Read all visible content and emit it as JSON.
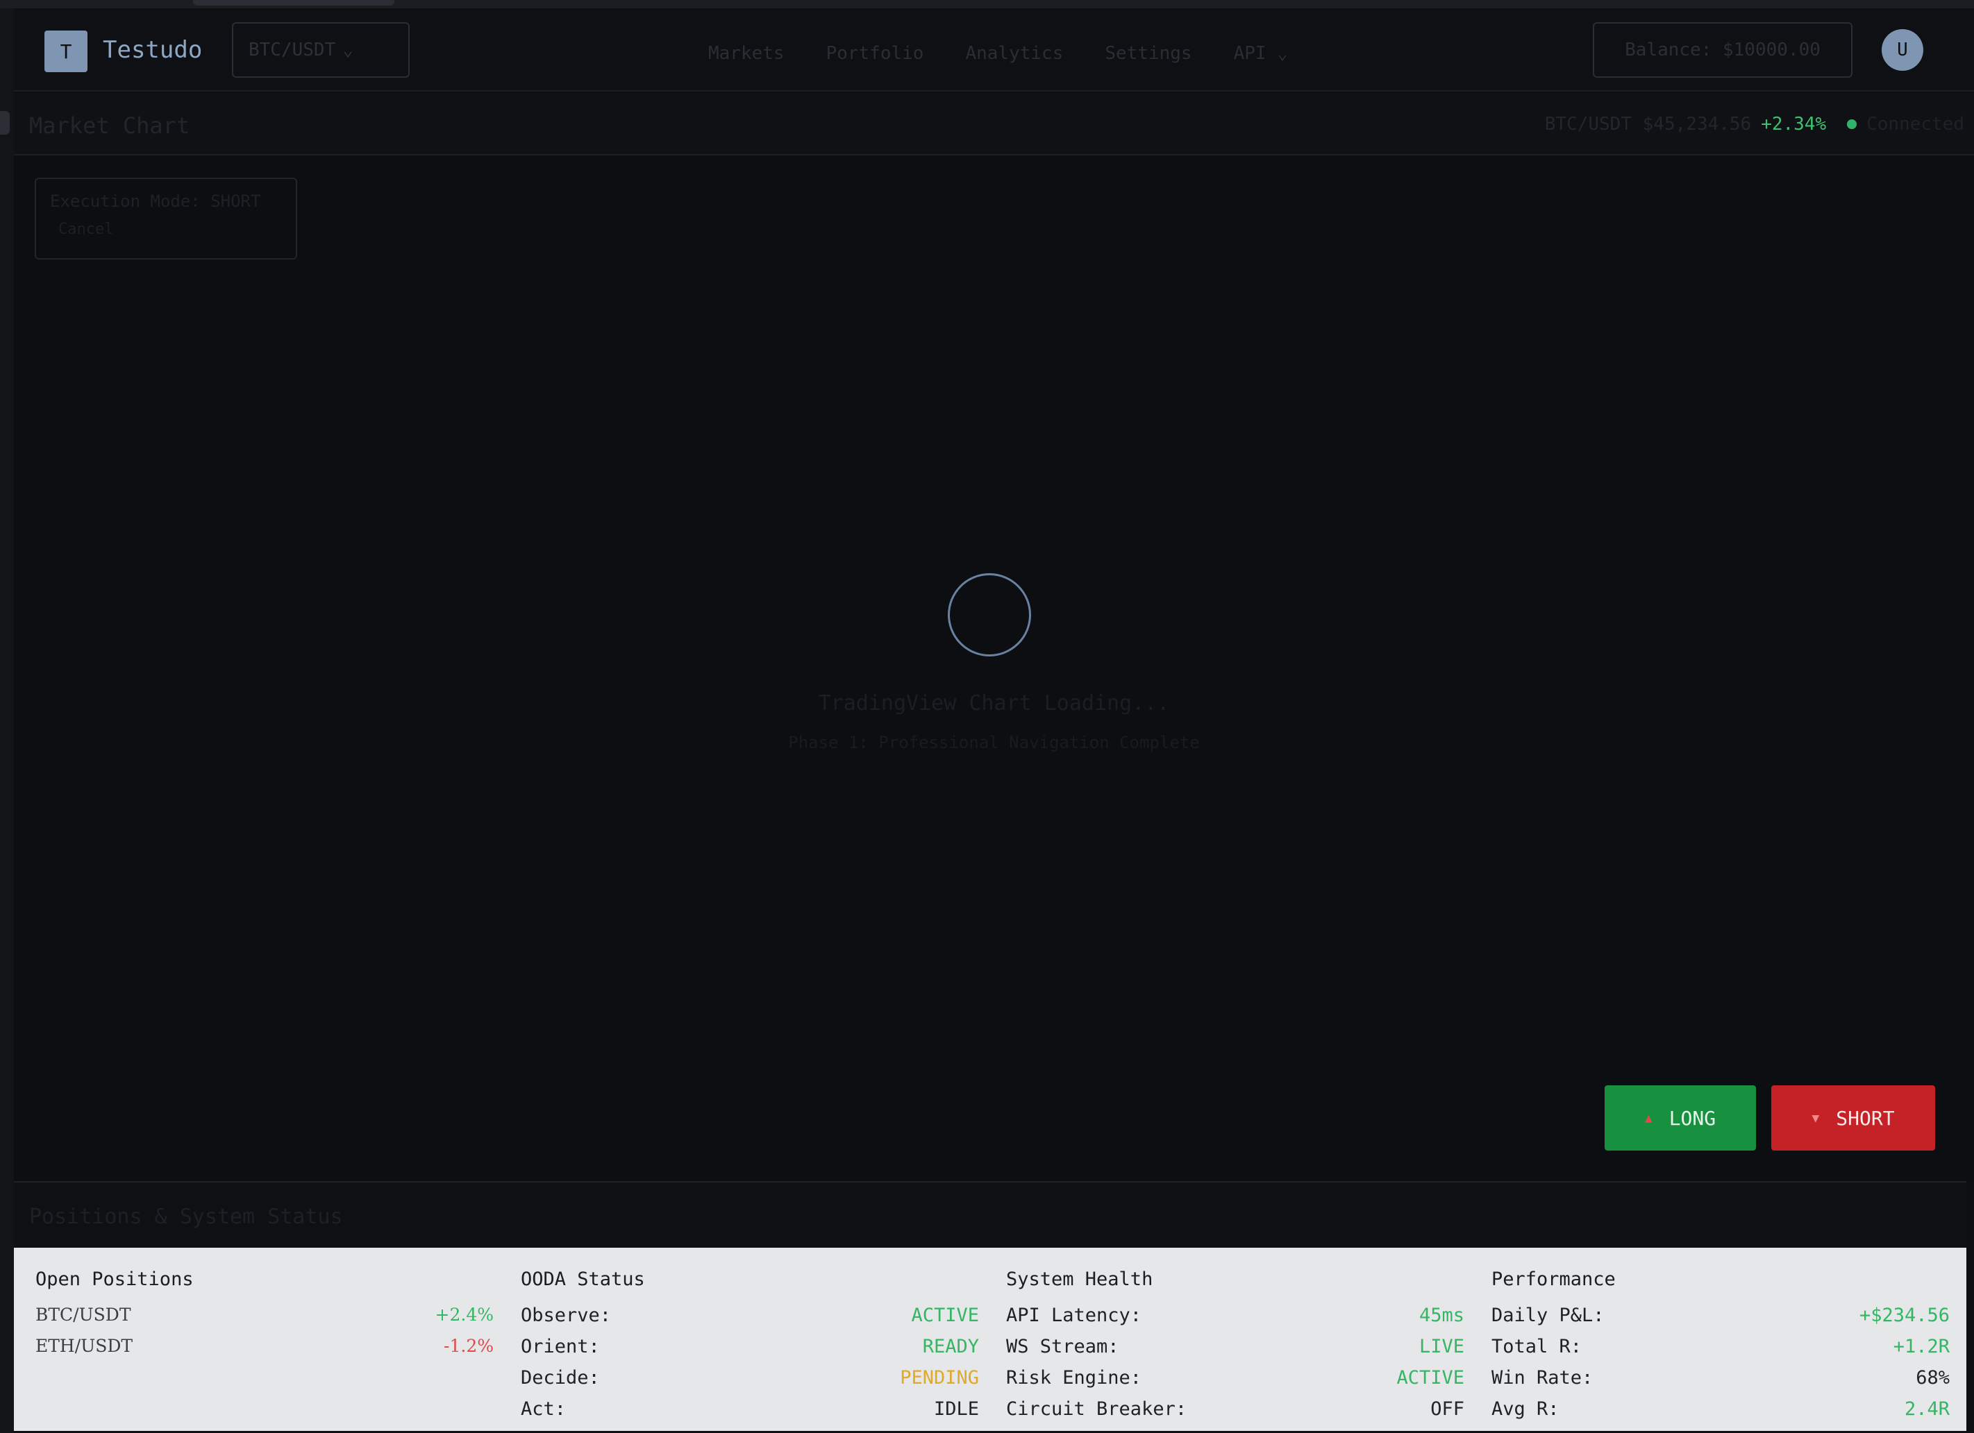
{
  "app": {
    "logo_letter": "T",
    "name": "Testudo"
  },
  "header": {
    "pair_select": "BTC/USDT",
    "nav": [
      "Markets",
      "Portfolio",
      "Analytics",
      "Settings",
      "API"
    ],
    "balance": "Balance: $10000.00",
    "avatar_letter": "U"
  },
  "chart": {
    "title": "Market Chart",
    "ticker_pair_price": "BTC/USDT $45,234.56",
    "ticker_change": "+2.34%",
    "connection": "Connected",
    "exec_mode": "Execution Mode: SHORT",
    "exec_cancel": "Cancel",
    "loading_title": "TradingView Chart Loading...",
    "loading_sub": "Phase 1: Professional Navigation Complete",
    "long_label": "LONG",
    "short_label": "SHORT",
    "colors": {
      "long": "#17913f",
      "short": "#c52227",
      "positive": "#36b565",
      "negative": "#e0484a",
      "pending": "#e0a92a"
    }
  },
  "bottom": {
    "title": "Positions & System Status",
    "open_positions": {
      "title": "Open Positions",
      "rows": [
        {
          "label": "BTC/USDT",
          "value": "+2.4%"
        },
        {
          "label": "ETH/USDT",
          "value": "-1.2%"
        }
      ]
    },
    "ooda": {
      "title": "OODA Status",
      "rows": [
        {
          "label": "Observe:",
          "value": "ACTIVE"
        },
        {
          "label": "Orient:",
          "value": "READY"
        },
        {
          "label": "Decide:",
          "value": "PENDING"
        },
        {
          "label": "Act:",
          "value": "IDLE"
        }
      ]
    },
    "health": {
      "title": "System Health",
      "rows": [
        {
          "label": "API Latency:",
          "value": "45ms"
        },
        {
          "label": "WS Stream:",
          "value": "LIVE"
        },
        {
          "label": "Risk Engine:",
          "value": "ACTIVE"
        },
        {
          "label": "Circuit Breaker:",
          "value": "OFF"
        }
      ]
    },
    "performance": {
      "title": "Performance",
      "rows": [
        {
          "label": "Daily P&L:",
          "value": "+$234.56"
        },
        {
          "label": "Total R:",
          "value": "+1.2R"
        },
        {
          "label": "Win Rate:",
          "value": "68%"
        },
        {
          "label": "Avg R:",
          "value": "2.4R"
        }
      ]
    }
  }
}
